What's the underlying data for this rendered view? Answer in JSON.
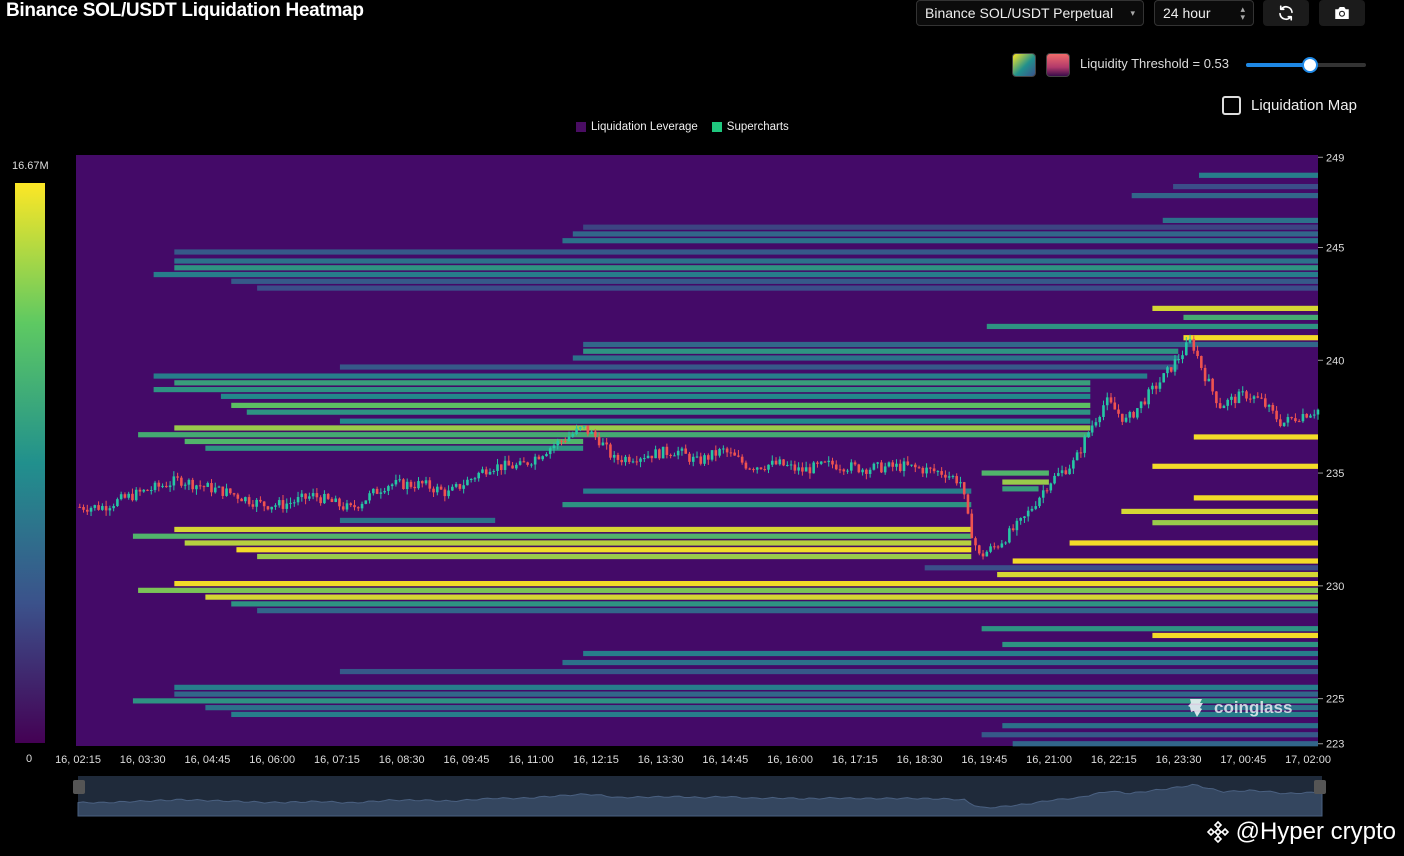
{
  "header": {
    "title": "Binance SOL/USDT Liquidation Heatmap",
    "pair_select": "Binance SOL/USDT Perpetual",
    "range_select": "24 hour",
    "refresh_icon": "refresh-icon",
    "camera_icon": "camera-icon"
  },
  "controls": {
    "threshold_label": "Liquidity Threshold = 0.53",
    "threshold_value": 0.53,
    "liquidation_map_label": "Liquidation Map",
    "liquidation_map_checked": false
  },
  "legend": {
    "items": [
      {
        "label": "Liquidation Leverage",
        "color": "#4a0d63"
      },
      {
        "label": "Supercharts",
        "color": "#1fc77e"
      }
    ]
  },
  "watermark": "coinglass",
  "footer": {
    "brand": "@Hyper  crypto"
  },
  "colors": {
    "background": "#000000",
    "plot_bg": "#440a68",
    "accent": "#1e88e5",
    "up": "#26c6a4",
    "down": "#ef5350",
    "scale_low": "#440154",
    "scale_mid": "#21908d",
    "scale_high": "#fde725"
  },
  "chart_data": {
    "type": "heatmap",
    "colorbar": {
      "max_label": "16.67M",
      "min_label": "0"
    },
    "x_ticks": [
      "16, 02:15",
      "16, 03:30",
      "16, 04:45",
      "16, 06:00",
      "16, 07:15",
      "16, 08:30",
      "16, 09:45",
      "16, 11:00",
      "16, 12:15",
      "16, 13:30",
      "16, 14:45",
      "16, 16:00",
      "16, 17:15",
      "16, 18:30",
      "16, 19:45",
      "16, 21:00",
      "16, 22:15",
      "16, 23:30",
      "17, 00:45",
      "17, 02:00"
    ],
    "x_range_hours": [
      0,
      24
    ],
    "y_ticks": [
      249,
      245,
      240,
      235,
      230,
      225,
      223
    ],
    "ylim": [
      222.9,
      249.1
    ],
    "price_path": [
      [
        0,
        233.5
      ],
      [
        0.5,
        233.5
      ],
      [
        1.2,
        234.1
      ],
      [
        2.0,
        234.7
      ],
      [
        2.3,
        234.5
      ],
      [
        3.0,
        234.1
      ],
      [
        3.6,
        233.6
      ],
      [
        4.0,
        233.6
      ],
      [
        4.6,
        234.0
      ],
      [
        5.3,
        233.4
      ],
      [
        6.0,
        234.5
      ],
      [
        6.7,
        234.5
      ],
      [
        7.2,
        234.1
      ],
      [
        8.0,
        235.3
      ],
      [
        8.6,
        235.3
      ],
      [
        9.2,
        236.2
      ],
      [
        9.8,
        237.0
      ],
      [
        10.1,
        236.5
      ],
      [
        10.4,
        235.6
      ],
      [
        11.0,
        235.8
      ],
      [
        11.6,
        236.0
      ],
      [
        12.0,
        235.5
      ],
      [
        12.5,
        236.0
      ],
      [
        13.0,
        235.3
      ],
      [
        13.6,
        235.4
      ],
      [
        14.0,
        235.1
      ],
      [
        14.6,
        235.4
      ],
      [
        15.2,
        235.2
      ],
      [
        16.0,
        235.3
      ],
      [
        16.8,
        235.0
      ],
      [
        17.1,
        234.6
      ],
      [
        17.25,
        232.8
      ],
      [
        17.45,
        231.3
      ],
      [
        17.8,
        231.8
      ],
      [
        18.3,
        232.9
      ],
      [
        18.8,
        234.6
      ],
      [
        19.3,
        235.5
      ],
      [
        19.6,
        237.0
      ],
      [
        19.9,
        238.2
      ],
      [
        20.3,
        237.3
      ],
      [
        20.7,
        238.4
      ],
      [
        21.0,
        239.2
      ],
      [
        21.4,
        240.4
      ],
      [
        21.55,
        240.9
      ],
      [
        21.8,
        239.4
      ],
      [
        22.1,
        238.0
      ],
      [
        22.6,
        238.5
      ],
      [
        22.9,
        238.2
      ],
      [
        23.3,
        237.2
      ],
      [
        23.7,
        237.6
      ],
      [
        24.0,
        237.8
      ]
    ],
    "bands": [
      {
        "price": 248.2,
        "x0": 21.7,
        "x1": 24,
        "v": 0.45
      },
      {
        "price": 247.7,
        "x0": 21.2,
        "x1": 24,
        "v": 0.25
      },
      {
        "price": 247.3,
        "x0": 20.4,
        "x1": 24,
        "v": 0.35
      },
      {
        "price": 246.2,
        "x0": 21.0,
        "x1": 24,
        "v": 0.4
      },
      {
        "price": 245.9,
        "x0": 9.8,
        "x1": 24,
        "v": 0.22
      },
      {
        "price": 245.6,
        "x0": 9.6,
        "x1": 24,
        "v": 0.35
      },
      {
        "price": 245.3,
        "x0": 9.4,
        "x1": 24,
        "v": 0.4
      },
      {
        "price": 244.8,
        "x0": 1.9,
        "x1": 24,
        "v": 0.3
      },
      {
        "price": 244.4,
        "x0": 1.9,
        "x1": 24,
        "v": 0.4
      },
      {
        "price": 244.1,
        "x0": 1.9,
        "x1": 24,
        "v": 0.55
      },
      {
        "price": 243.8,
        "x0": 1.5,
        "x1": 24,
        "v": 0.45
      },
      {
        "price": 243.5,
        "x0": 3.0,
        "x1": 24,
        "v": 0.3
      },
      {
        "price": 243.2,
        "x0": 3.5,
        "x1": 24,
        "v": 0.25
      },
      {
        "price": 242.3,
        "x0": 20.8,
        "x1": 24,
        "v": 0.95
      },
      {
        "price": 241.9,
        "x0": 21.4,
        "x1": 24,
        "v": 0.65
      },
      {
        "price": 241.5,
        "x0": 17.6,
        "x1": 24,
        "v": 0.55
      },
      {
        "price": 241.0,
        "x0": 21.4,
        "x1": 24,
        "v": 1.0
      },
      {
        "price": 240.7,
        "x0": 9.8,
        "x1": 24,
        "v": 0.35
      },
      {
        "price": 240.4,
        "x0": 9.8,
        "x1": 21.3,
        "v": 0.55
      },
      {
        "price": 240.1,
        "x0": 9.6,
        "x1": 21.3,
        "v": 0.4
      },
      {
        "price": 239.7,
        "x0": 5.1,
        "x1": 21.3,
        "v": 0.3
      },
      {
        "price": 239.3,
        "x0": 1.5,
        "x1": 20.7,
        "v": 0.45
      },
      {
        "price": 239.0,
        "x0": 1.9,
        "x1": 19.6,
        "v": 0.6
      },
      {
        "price": 238.7,
        "x0": 1.5,
        "x1": 19.6,
        "v": 0.55
      },
      {
        "price": 238.4,
        "x0": 2.8,
        "x1": 19.6,
        "v": 0.5
      },
      {
        "price": 238.0,
        "x0": 3.0,
        "x1": 19.6,
        "v": 0.75
      },
      {
        "price": 237.7,
        "x0": 3.3,
        "x1": 19.6,
        "v": 0.55
      },
      {
        "price": 237.3,
        "x0": 5.1,
        "x1": 19.6,
        "v": 0.5
      },
      {
        "price": 237.0,
        "x0": 1.9,
        "x1": 19.6,
        "v": 0.85
      },
      {
        "price": 236.7,
        "x0": 1.2,
        "x1": 19.6,
        "v": 0.65
      },
      {
        "price": 236.4,
        "x0": 2.1,
        "x1": 9.8,
        "v": 0.7
      },
      {
        "price": 236.1,
        "x0": 2.5,
        "x1": 9.8,
        "v": 0.55
      },
      {
        "price": 236.6,
        "x0": 21.6,
        "x1": 24,
        "v": 1.0
      },
      {
        "price": 235.3,
        "x0": 20.8,
        "x1": 24,
        "v": 1.0
      },
      {
        "price": 235.0,
        "x0": 17.5,
        "x1": 18.8,
        "v": 0.7
      },
      {
        "price": 234.6,
        "x0": 17.9,
        "x1": 18.8,
        "v": 0.85
      },
      {
        "price": 234.3,
        "x0": 17.9,
        "x1": 18.6,
        "v": 0.6
      },
      {
        "price": 234.2,
        "x0": 9.8,
        "x1": 17.3,
        "v": 0.45
      },
      {
        "price": 233.9,
        "x0": 21.6,
        "x1": 24,
        "v": 1.0
      },
      {
        "price": 233.6,
        "x0": 9.4,
        "x1": 17.3,
        "v": 0.55
      },
      {
        "price": 233.3,
        "x0": 20.2,
        "x1": 24,
        "v": 0.95
      },
      {
        "price": 232.9,
        "x0": 5.1,
        "x1": 8.1,
        "v": 0.4
      },
      {
        "price": 232.8,
        "x0": 20.8,
        "x1": 24,
        "v": 0.85
      },
      {
        "price": 232.5,
        "x0": 1.9,
        "x1": 17.3,
        "v": 0.95
      },
      {
        "price": 232.2,
        "x0": 1.1,
        "x1": 17.3,
        "v": 0.7
      },
      {
        "price": 231.9,
        "x0": 2.1,
        "x1": 17.3,
        "v": 0.9
      },
      {
        "price": 231.6,
        "x0": 3.1,
        "x1": 17.3,
        "v": 1.0
      },
      {
        "price": 231.3,
        "x0": 3.5,
        "x1": 17.3,
        "v": 0.85
      },
      {
        "price": 231.9,
        "x0": 19.2,
        "x1": 24,
        "v": 1.0
      },
      {
        "price": 231.1,
        "x0": 18.1,
        "x1": 24,
        "v": 1.0
      },
      {
        "price": 230.8,
        "x0": 16.4,
        "x1": 24,
        "v": 0.25
      },
      {
        "price": 230.5,
        "x0": 17.8,
        "x1": 24,
        "v": 0.95
      },
      {
        "price": 230.1,
        "x0": 1.9,
        "x1": 24,
        "v": 1.0
      },
      {
        "price": 229.8,
        "x0": 1.2,
        "x1": 24,
        "v": 0.8
      },
      {
        "price": 229.5,
        "x0": 2.5,
        "x1": 24,
        "v": 0.95
      },
      {
        "price": 229.2,
        "x0": 3.0,
        "x1": 24,
        "v": 0.55
      },
      {
        "price": 228.9,
        "x0": 3.5,
        "x1": 24,
        "v": 0.35
      },
      {
        "price": 228.1,
        "x0": 17.5,
        "x1": 24,
        "v": 0.55
      },
      {
        "price": 227.8,
        "x0": 20.8,
        "x1": 24,
        "v": 1.0
      },
      {
        "price": 227.4,
        "x0": 17.9,
        "x1": 24,
        "v": 0.55
      },
      {
        "price": 227.0,
        "x0": 9.8,
        "x1": 24,
        "v": 0.45
      },
      {
        "price": 226.6,
        "x0": 9.4,
        "x1": 24,
        "v": 0.4
      },
      {
        "price": 226.2,
        "x0": 5.1,
        "x1": 24,
        "v": 0.3
      },
      {
        "price": 225.5,
        "x0": 1.9,
        "x1": 24,
        "v": 0.45
      },
      {
        "price": 225.2,
        "x0": 1.9,
        "x1": 24,
        "v": 0.35
      },
      {
        "price": 224.9,
        "x0": 1.1,
        "x1": 24,
        "v": 0.55
      },
      {
        "price": 224.6,
        "x0": 2.5,
        "x1": 24,
        "v": 0.4
      },
      {
        "price": 224.3,
        "x0": 3.0,
        "x1": 24,
        "v": 0.45
      },
      {
        "price": 223.8,
        "x0": 17.9,
        "x1": 24,
        "v": 0.4
      },
      {
        "price": 223.4,
        "x0": 17.5,
        "x1": 24,
        "v": 0.3
      },
      {
        "price": 223.0,
        "x0": 18.1,
        "x1": 24,
        "v": 0.35
      }
    ]
  }
}
